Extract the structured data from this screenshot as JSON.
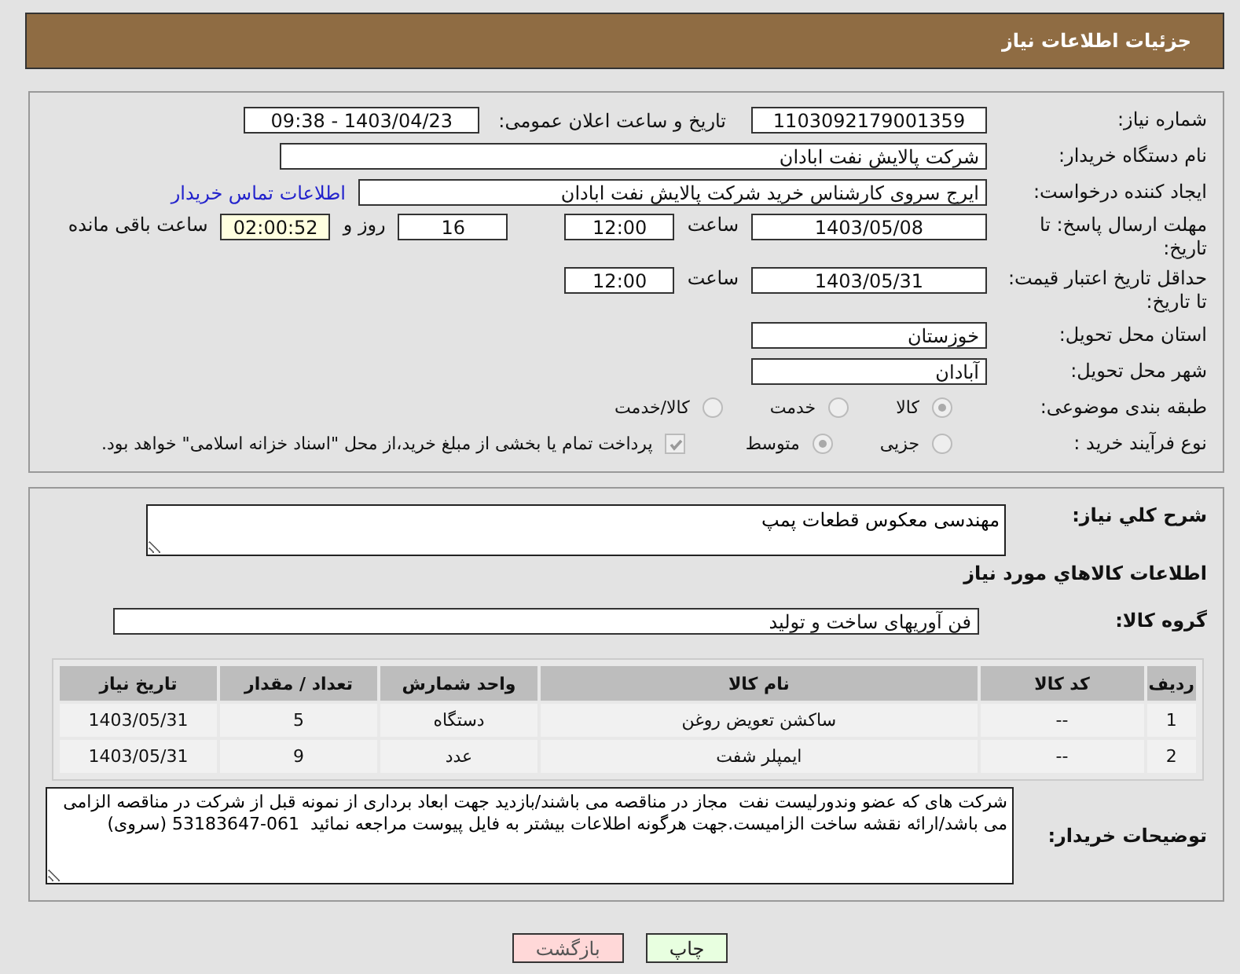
{
  "header": {
    "title": "جزئیات اطلاعات نیاز"
  },
  "details": {
    "need_number": {
      "label": "شماره نیاز:",
      "value": "1103092179001359"
    },
    "announce": {
      "label": "تاریخ و ساعت اعلان عمومی:",
      "value": "1403/04/23 - 09:38"
    },
    "buyer": {
      "label": "نام دستگاه خریدار:",
      "value": "شرکت پالایش نفت ابادان"
    },
    "creator": {
      "label": "ایجاد کننده درخواست:",
      "value": "ایرج سروی کارشناس خرید شرکت پالایش نفت ابادان",
      "link": "اطلاعات تماس خریدار"
    },
    "deadline": {
      "label": "مهلت ارسال پاسخ: تا تاریخ:",
      "date": "1403/05/08",
      "time_label": "ساعت",
      "time": "12:00",
      "days": "16",
      "days_label": "روز و",
      "remaining": "02:00:52",
      "remaining_label": "ساعت باقی مانده"
    },
    "validity": {
      "label": "حداقل تاریخ اعتبار قیمت: تا تاریخ:",
      "date": "1403/05/31",
      "time_label": "ساعت",
      "time": "12:00"
    },
    "province": {
      "label": "استان محل تحویل:",
      "value": "خوزستان"
    },
    "city": {
      "label": "شهر محل تحویل:",
      "value": "آبادان"
    },
    "category": {
      "label": "طبقه بندی موضوعی:",
      "options": [
        {
          "label": "کالا",
          "selected": true
        },
        {
          "label": "خدمت",
          "selected": false
        },
        {
          "label": "کالا/خدمت",
          "selected": false
        }
      ]
    },
    "process": {
      "label": "نوع فرآیند خرید :",
      "options": [
        {
          "label": "جزیی",
          "selected": false
        },
        {
          "label": "متوسط",
          "selected": true
        }
      ],
      "payment": {
        "checked": true,
        "text": "پرداخت تمام یا بخشی از مبلغ خرید،از محل \"اسناد خزانه اسلامی\" خواهد بود."
      }
    }
  },
  "goods": {
    "description": {
      "label": "شرح کلي نياز:",
      "value": "مهندسی معکوس قطعات پمپ"
    },
    "section_title": "اطلاعات کالاهاي مورد نياز",
    "group": {
      "label": "گروه کالا:",
      "value": "فن آوریهای ساخت و تولید"
    },
    "table": {
      "columns": [
        "ردیف",
        "کد کالا",
        "نام کالا",
        "واحد شمارش",
        "تعداد / مقدار",
        "تاریخ نیاز"
      ],
      "rows": [
        [
          "1",
          "--",
          "ساکشن تعویض روغن",
          "دستگاه",
          "5",
          "1403/05/31"
        ],
        [
          "2",
          "--",
          "ایمپلر شفت",
          "عدد",
          "9",
          "1403/05/31"
        ]
      ]
    },
    "notes": {
      "label": "توضیحات خریدار:",
      "value": "شرکت های که عضو وندورلیست نفت  مجاز در مناقصه می باشند/بازدید جهت ابعاد برداری از نمونه قبل از شرکت در مناقصه الزامی می باشد/ارائه نقشه ساخت الزامیست.جهت هرگونه اطلاعات بیشتر به فایل پیوست مراجعه نمائید  061-53183647 (سروی)"
    }
  },
  "buttons": [
    {
      "kind": "print",
      "label": "چاپ"
    },
    {
      "kind": "back",
      "label": "بازگشت"
    }
  ]
}
